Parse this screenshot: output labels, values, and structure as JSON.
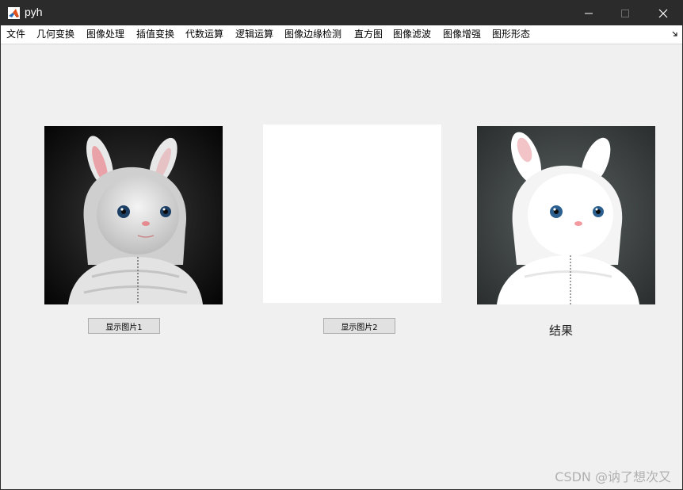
{
  "window": {
    "title": "pyh",
    "minimize_glyph": "minimize-icon",
    "maximize_glyph": "maximize-icon",
    "close_glyph": "close-icon"
  },
  "menu": {
    "items": [
      "文件",
      "几何变换",
      "图像处理",
      "插值变换",
      "代数运算",
      "逻辑运算",
      "图像边缘检测",
      "直方图",
      "图像滤波",
      "图像增强",
      "图形形态"
    ]
  },
  "panels": {
    "button1_label": "显示图片1",
    "button2_label": "显示图片2",
    "result_label": "结果"
  },
  "watermark": "CSDN @讷了想次又",
  "colors": {
    "titlebar": "#2b2b2b",
    "background": "#f0f0f0",
    "button_face": "#e1e1e1"
  }
}
